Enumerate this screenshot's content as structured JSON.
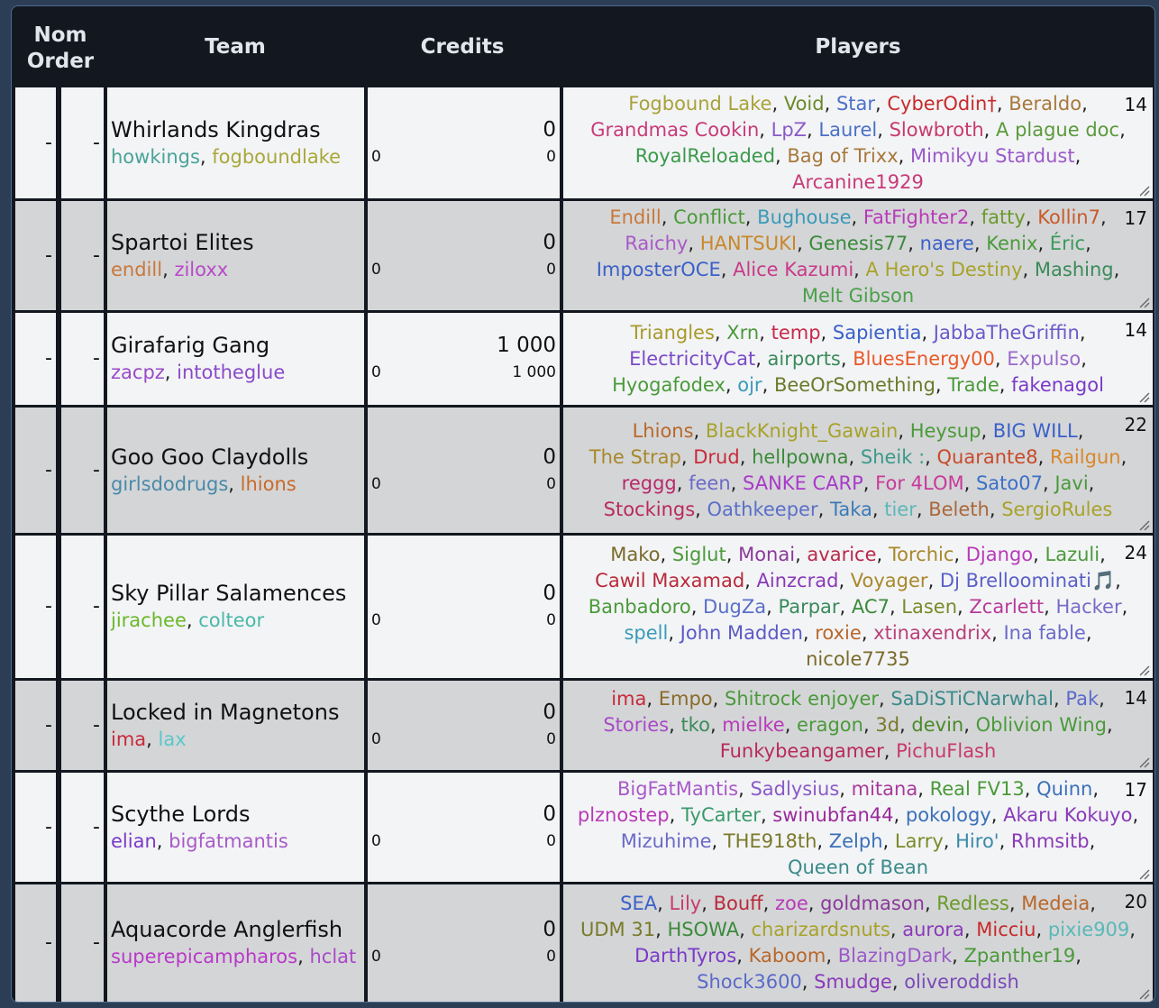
{
  "header": {
    "nom_line1": "Nom",
    "nom_line2": "Order",
    "team": "Team",
    "credits": "Credits",
    "players": "Players"
  },
  "teams": [
    {
      "nom": "-",
      "order": "-",
      "name": "Whirlands Kingdras",
      "managers": [
        {
          "name": "howkings",
          "color": "#4aa39a"
        },
        {
          "name": "fogboundlake",
          "color": "#a8a83a"
        }
      ],
      "credits": "0",
      "credits_sub": "0",
      "credits_left": "0",
      "count": "14",
      "players": [
        [
          {
            "name": "Fogbound Lake",
            "color": "#a8a23a"
          },
          {
            "name": "Void",
            "color": "#6a8a2a"
          },
          {
            "name": "Star",
            "color": "#4a70c8"
          },
          {
            "name": "CyberOdin†",
            "color": "#c82a2a"
          },
          {
            "name": "Beraldo",
            "color": "#a8783a"
          }
        ],
        [
          {
            "name": "Grandmas Cookin",
            "color": "#c83a78"
          },
          {
            "name": "LpZ",
            "color": "#8a5ac8"
          },
          {
            "name": "Laurel",
            "color": "#4a70c8"
          },
          {
            "name": "Slowbroth",
            "color": "#c83a6a"
          },
          {
            "name": "A plague doc",
            "color": "#5a9a3a"
          }
        ],
        [
          {
            "name": "RoyalReloaded",
            "color": "#3a9a4a"
          },
          {
            "name": "Bag of Trixx",
            "color": "#a8783a"
          },
          {
            "name": "Mimikyu Stardust",
            "color": "#9a5ac8"
          }
        ],
        [
          {
            "name": "Arcanine1929",
            "color": "#c83a78"
          }
        ]
      ]
    },
    {
      "nom": "-",
      "order": "-",
      "name": "Spartoi Elites",
      "managers": [
        {
          "name": "endill",
          "color": "#c8783a"
        },
        {
          "name": "ziloxx",
          "color": "#b84ac8"
        }
      ],
      "credits": "0",
      "credits_sub": "0",
      "credits_left": "0",
      "count": "17",
      "players": [
        [
          {
            "name": "Endill",
            "color": "#c8783a"
          },
          {
            "name": "Conflict",
            "color": "#4a9a3a"
          },
          {
            "name": "Bughouse",
            "color": "#3a9ab8"
          },
          {
            "name": "FatFighter2",
            "color": "#b83ab8"
          },
          {
            "name": "fatty",
            "color": "#6a9a2a"
          },
          {
            "name": "Kollin7",
            "color": "#c85a2a"
          }
        ],
        [
          {
            "name": "Raichy",
            "color": "#a85ac8"
          },
          {
            "name": "HANTSUKI",
            "color": "#c8882a"
          },
          {
            "name": "Genesis77",
            "color": "#3a8a3a"
          },
          {
            "name": "naere",
            "color": "#3a60c8"
          },
          {
            "name": "Kenix",
            "color": "#4a9a3a"
          },
          {
            "name": "Éric",
            "color": "#3a9a5a"
          }
        ],
        [
          {
            "name": "ImposterOCE",
            "color": "#3a60c8"
          },
          {
            "name": "Alice Kazumi",
            "color": "#c83a8a"
          },
          {
            "name": "A Hero's Destiny",
            "color": "#a8a22a"
          },
          {
            "name": "Mashing",
            "color": "#3a8a5a"
          }
        ],
        [
          {
            "name": "Melt Gibson",
            "color": "#4aa04a"
          }
        ]
      ]
    },
    {
      "nom": "-",
      "order": "-",
      "name": "Girafarig Gang",
      "managers": [
        {
          "name": "zacpz",
          "color": "#9a4ac8"
        },
        {
          "name": "intotheglue",
          "color": "#8a4ac8"
        }
      ],
      "credits": "1 000",
      "credits_sub": "1 000",
      "credits_left": "0",
      "count": "14",
      "players": [
        [
          {
            "name": "Triangles",
            "color": "#a89a2a"
          },
          {
            "name": "Xrn",
            "color": "#4a9a3a"
          },
          {
            "name": "temp",
            "color": "#c82a4a"
          },
          {
            "name": "Sapientia",
            "color": "#3a60c8"
          },
          {
            "name": "JabbaTheGriffin",
            "color": "#6a5ac8"
          }
        ],
        [
          {
            "name": "ElectricityCat",
            "color": "#7a4ac8"
          },
          {
            "name": "airports",
            "color": "#3a8a5a"
          },
          {
            "name": "BluesEnergy00",
            "color": "#e85a2a"
          },
          {
            "name": "Expulso",
            "color": "#9a6ac8"
          }
        ],
        [
          {
            "name": "Hyogafodex",
            "color": "#4a9a3a"
          },
          {
            "name": "ojr",
            "color": "#3a9ab8"
          },
          {
            "name": "BeeOrSomething",
            "color": "#6a7a2a"
          },
          {
            "name": "Trade",
            "color": "#4a9a3a"
          },
          {
            "name": "fakenagol",
            "color": "#7a3ac8"
          }
        ]
      ]
    },
    {
      "nom": "-",
      "order": "-",
      "name": "Goo Goo Claydolls",
      "managers": [
        {
          "name": "girlsdodrugs",
          "color": "#4a8aa8"
        },
        {
          "name": "lhions",
          "color": "#c86a2a"
        }
      ],
      "credits": "0",
      "credits_sub": "0",
      "credits_left": "0",
      "count": "22",
      "players": [
        [
          {
            "name": "Lhions",
            "color": "#b8682a"
          },
          {
            "name": "BlackKnight_Gawain",
            "color": "#a8a22a"
          },
          {
            "name": "Heysup",
            "color": "#4a9a3a"
          },
          {
            "name": "BIG WILL",
            "color": "#3a60c8"
          }
        ],
        [
          {
            "name": "The Strap",
            "color": "#a8882a"
          },
          {
            "name": "Drud",
            "color": "#c82a3a"
          },
          {
            "name": "hellpowna",
            "color": "#3a8a3a"
          },
          {
            "name": "Sheik :",
            "color": "#3a9a8a"
          },
          {
            "name": "Quarante8",
            "color": "#c84a2a"
          },
          {
            "name": "Railgun",
            "color": "#d8882a"
          }
        ],
        [
          {
            "name": "reggg",
            "color": "#b82a6a"
          },
          {
            "name": "feen",
            "color": "#6a6ac8"
          },
          {
            "name": "SANKE CARP",
            "color": "#a83ac8"
          },
          {
            "name": "For 4LOM",
            "color": "#c83a9a"
          },
          {
            "name": "Sato07",
            "color": "#3a70c8"
          },
          {
            "name": "Javi",
            "color": "#4a9a3a"
          }
        ],
        [
          {
            "name": "Stockings",
            "color": "#b82a5a"
          },
          {
            "name": "Oathkeeper",
            "color": "#5a70c8"
          },
          {
            "name": "Taka",
            "color": "#3a7ab8"
          },
          {
            "name": "tier",
            "color": "#5ab8b8"
          },
          {
            "name": "Beleth",
            "color": "#a8683a"
          },
          {
            "name": "SergioRules",
            "color": "#a8a22a"
          }
        ]
      ]
    },
    {
      "nom": "-",
      "order": "-",
      "name": "Sky Pillar Salamences",
      "managers": [
        {
          "name": "jirachee",
          "color": "#6ab82a"
        },
        {
          "name": "colteor",
          "color": "#4ab8a8"
        }
      ],
      "credits": "0",
      "credits_sub": "0",
      "credits_left": "0",
      "count": "24",
      "players": [
        [
          {
            "name": "Mako",
            "color": "#7a6a2a"
          },
          {
            "name": "Siglut",
            "color": "#4a9a3a"
          },
          {
            "name": "Monai",
            "color": "#8a3a9a"
          },
          {
            "name": "avarice",
            "color": "#b82a4a"
          },
          {
            "name": "Torchic",
            "color": "#a8882a"
          },
          {
            "name": "Django",
            "color": "#b83ab8"
          },
          {
            "name": "Lazuli",
            "color": "#4a9a3a"
          }
        ],
        [
          {
            "name": "Cawil Maxamad",
            "color": "#b82a3a"
          },
          {
            "name": "Ainzcrad",
            "color": "#8a3ab8"
          },
          {
            "name": "Voyager",
            "color": "#a8882a"
          },
          {
            "name": "Dj Brelloominati🎵",
            "color": "#5a60c8"
          }
        ],
        [
          {
            "name": "Banbadoro",
            "color": "#4a9a3a"
          },
          {
            "name": "DugZa",
            "color": "#5a70c8"
          },
          {
            "name": "Parpar",
            "color": "#3a8a5a"
          },
          {
            "name": "AC7",
            "color": "#3a8a3a"
          },
          {
            "name": "Lasen",
            "color": "#7a8a2a"
          },
          {
            "name": "Zcarlett",
            "color": "#b83a9a"
          },
          {
            "name": "Hacker",
            "color": "#7a6ac8"
          }
        ],
        [
          {
            "name": "spell",
            "color": "#3a9ab8"
          },
          {
            "name": "John Madden",
            "color": "#5a5ac8"
          },
          {
            "name": "roxie",
            "color": "#b8682a"
          },
          {
            "name": "xtinaxendrix",
            "color": "#b8407a"
          },
          {
            "name": "Ina fable",
            "color": "#6a6ac8"
          }
        ],
        [
          {
            "name": "nicole7735",
            "color": "#7a6a2a"
          }
        ]
      ]
    },
    {
      "nom": "-",
      "order": "-",
      "name": "Locked in Magnetons",
      "managers": [
        {
          "name": "ima",
          "color": "#c82a3a"
        },
        {
          "name": "lax",
          "color": "#5ac8c8"
        }
      ],
      "credits": "0",
      "credits_sub": "0",
      "credits_left": "0",
      "count": "14",
      "players": [
        [
          {
            "name": "ima",
            "color": "#c82a3a"
          },
          {
            "name": "Empo",
            "color": "#8a6a2a"
          },
          {
            "name": "Shitrock enjoyer",
            "color": "#4a9a3a"
          },
          {
            "name": "SaDiSTiCNarwhal",
            "color": "#3a8a8a"
          },
          {
            "name": "Pak",
            "color": "#5a6ac8"
          }
        ],
        [
          {
            "name": "Stories",
            "color": "#a84ac8"
          },
          {
            "name": "tko",
            "color": "#3a8a5a"
          },
          {
            "name": "mielke",
            "color": "#b83ab8"
          },
          {
            "name": "eragon",
            "color": "#4a9a3a"
          },
          {
            "name": "3d",
            "color": "#7a7a2a"
          },
          {
            "name": "devin",
            "color": "#4a8a2a"
          },
          {
            "name": "Oblivion Wing",
            "color": "#4a9a3a"
          }
        ],
        [
          {
            "name": "Funkybeangamer",
            "color": "#b82a5a"
          },
          {
            "name": "PichuFlash",
            "color": "#c83a6a"
          }
        ]
      ]
    },
    {
      "nom": "-",
      "order": "-",
      "name": "Scythe Lords",
      "managers": [
        {
          "name": "elian",
          "color": "#7a3ac8"
        },
        {
          "name": "bigfatmantis",
          "color": "#a85ac8"
        }
      ],
      "credits": "0",
      "credits_sub": "0",
      "credits_left": "0",
      "count": "17",
      "players": [
        [
          {
            "name": "BigFatMantis",
            "color": "#a85ac8"
          },
          {
            "name": "Sadlysius",
            "color": "#8a5ac8"
          },
          {
            "name": "mitana",
            "color": "#a83a9a"
          },
          {
            "name": "Real FV13",
            "color": "#4a9a3a"
          },
          {
            "name": "Quinn",
            "color": "#3a70b8"
          }
        ],
        [
          {
            "name": "plznostep",
            "color": "#b83ab8"
          },
          {
            "name": "TyCarter",
            "color": "#3a9a6a"
          },
          {
            "name": "swinubfan44",
            "color": "#9a2a9a"
          },
          {
            "name": "pokology",
            "color": "#3a70b8"
          },
          {
            "name": "Akaru Kokuyo",
            "color": "#8a3ab8"
          }
        ],
        [
          {
            "name": "Mizuhime",
            "color": "#6a6ac8"
          },
          {
            "name": "THE918th",
            "color": "#7a7a2a"
          },
          {
            "name": "Zelph",
            "color": "#3a70b8"
          },
          {
            "name": "Larry",
            "color": "#7a8a2a"
          },
          {
            "name": "Hiro'",
            "color": "#3a8aa8"
          },
          {
            "name": "Rhmsitb",
            "color": "#8a3ab8"
          }
        ],
        [
          {
            "name": "Queen of Bean",
            "color": "#3a8a8a"
          }
        ]
      ]
    },
    {
      "nom": "-",
      "order": "-",
      "name": "Aquacorde Anglerfish",
      "managers": [
        {
          "name": "superepicampharos",
          "color": "#b83ac8"
        },
        {
          "name": "hclat",
          "color": "#a84ac8"
        }
      ],
      "credits": "0",
      "credits_sub": "0",
      "credits_left": "0",
      "count": "20",
      "players": [
        [
          {
            "name": "SEA",
            "color": "#3a60c8"
          },
          {
            "name": "Lily",
            "color": "#c83a6a"
          },
          {
            "name": "Bouff",
            "color": "#b82a3a"
          },
          {
            "name": "zoe",
            "color": "#b83ab8"
          },
          {
            "name": "goldmason",
            "color": "#8a3a9a"
          },
          {
            "name": "Redless",
            "color": "#6a9a2a"
          },
          {
            "name": "Medeia",
            "color": "#b8682a"
          }
        ],
        [
          {
            "name": "UDM 31",
            "color": "#7a7a2a"
          },
          {
            "name": "HSOWA",
            "color": "#3a8a3a"
          },
          {
            "name": "charizardsnuts",
            "color": "#a8a22a"
          },
          {
            "name": "aurora",
            "color": "#8a3ab8"
          },
          {
            "name": "Micciu",
            "color": "#c82a2a"
          },
          {
            "name": "pixie909",
            "color": "#5ab8b8"
          }
        ],
        [
          {
            "name": "DarthTyros",
            "color": "#7a3ac8"
          },
          {
            "name": "Kaboom",
            "color": "#b8682a"
          },
          {
            "name": "BlazingDark",
            "color": "#9a5ac8"
          },
          {
            "name": "Zpanther19",
            "color": "#4a9a3a"
          }
        ],
        [
          {
            "name": "Shock3600",
            "color": "#5a6ac8"
          },
          {
            "name": "Smudge",
            "color": "#8a3ab8"
          },
          {
            "name": "oliveroddish",
            "color": "#7a4ab8"
          }
        ]
      ]
    }
  ]
}
